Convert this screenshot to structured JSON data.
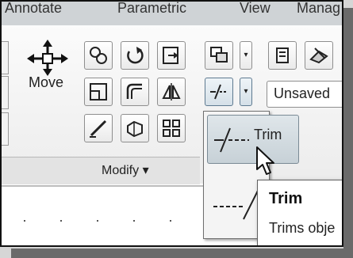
{
  "tabs": [
    {
      "label": "Annotate"
    },
    {
      "label": "Parametric"
    },
    {
      "label": "View"
    },
    {
      "label": "Manag"
    }
  ],
  "ribbon": {
    "move_label": "Move",
    "panel_title": "Modify",
    "panel_arrow": "▾",
    "combo_value": "Unsaved"
  },
  "flyout": {
    "item_label": "Trim"
  },
  "tooltip": {
    "title": "Trim",
    "text": "Trims obje"
  }
}
